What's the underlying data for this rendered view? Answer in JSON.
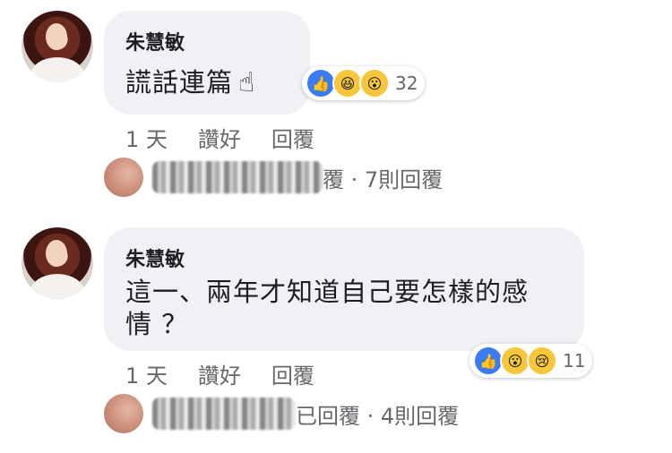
{
  "comments": [
    {
      "author": "朱慧敏",
      "text": "謊話連篇",
      "emoji": "☝",
      "reaction_count": "32",
      "reactions": [
        "like",
        "haha",
        "wow"
      ],
      "time": "1 天",
      "like_label": "讚好",
      "reply_label": "回覆",
      "replies_text": "覆 · 7則回覆"
    },
    {
      "author": "朱慧敏",
      "text_line1": "這一、兩年才知道自己要怎樣的感",
      "text_line2": "情 ？",
      "reaction_count": "11",
      "reactions": [
        "like",
        "wow",
        "sad"
      ],
      "time": "1 天",
      "like_label": "讚好",
      "reply_label": "回覆",
      "replies_text": "已回覆 · 4則回覆"
    }
  ]
}
